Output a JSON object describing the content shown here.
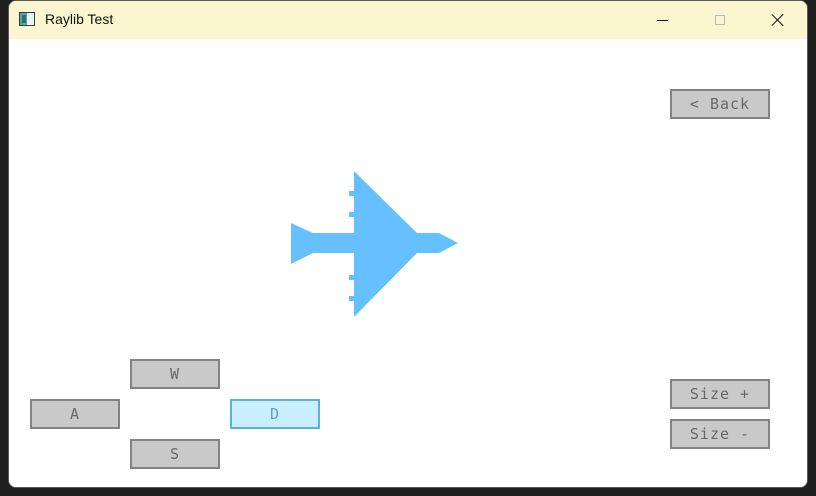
{
  "window": {
    "title": "Raylib Test",
    "titlebar_color": "#fbf6cf"
  },
  "caption": {
    "minimize_icon": "minimize-icon",
    "maximize_icon": "maximize-icon",
    "close_icon": "close-icon"
  },
  "canvas": {
    "plane_color": "#66bfff",
    "icon": "airplane-icon"
  },
  "buttons": {
    "back": "< Back",
    "w": "W",
    "a": "A",
    "s": "S",
    "d": "D",
    "size_plus": "Size +",
    "size_minus": "Size -"
  },
  "colors": {
    "button_bg": "#c9c9c9",
    "button_border": "#838383",
    "button_text": "#686868",
    "active_bg": "#c9effe",
    "active_border": "#5bb2d9",
    "active_text": "#6c9bbc"
  }
}
